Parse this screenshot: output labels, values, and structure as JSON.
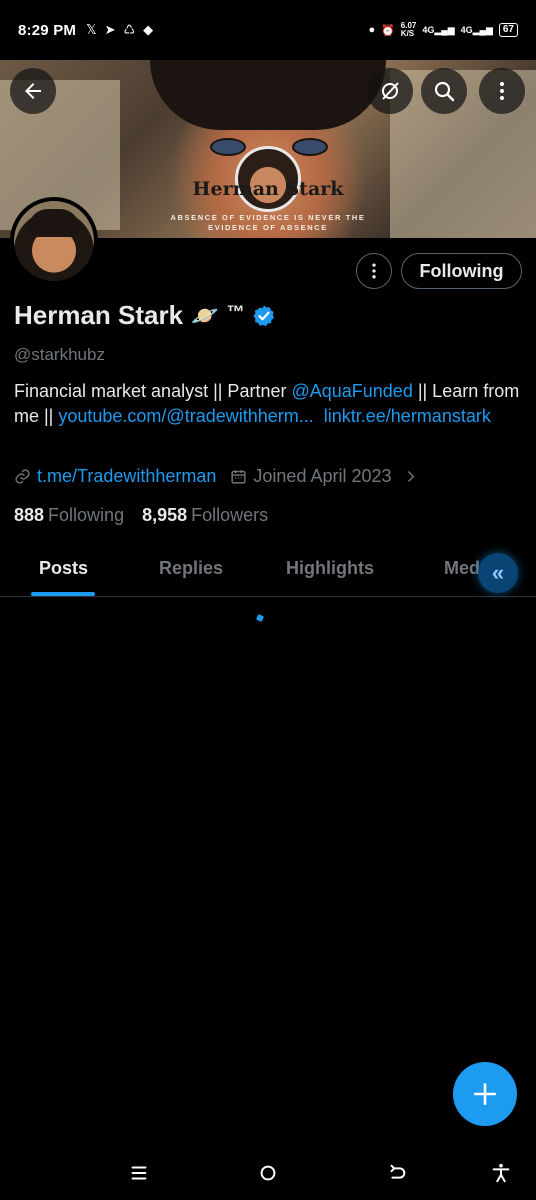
{
  "status_bar": {
    "time": "8:29 PM",
    "left_icons": [
      "x-icon",
      "telegram-icon",
      "recycle-icon",
      "android-icon"
    ],
    "net_speed": "6.07",
    "net_unit": "K/S",
    "signal_1": "4G",
    "signal_2": "4G",
    "battery": "67"
  },
  "banner": {
    "title": "Herman Stark",
    "subtitle_line1": "ABSENCE OF EVIDENCE IS NEVER THE",
    "subtitle_line2": "EVIDENCE OF ABSENCE"
  },
  "actions": {
    "following_label": "Following"
  },
  "profile": {
    "display_name": "Herman Stark",
    "name_emoji": "🪐",
    "name_suffix": "™",
    "handle": "@starkhubz",
    "bio_part1": "Financial market analyst || Partner ",
    "bio_mention": "@AquaFunded",
    "bio_part2": " || Learn from me || ",
    "bio_link1": "youtube.com/@tradewithherm...",
    "bio_sep": "  ",
    "bio_link2": "linktr.ee/hermanstark",
    "website": "t.me/Tradewithherman",
    "joined": "Joined April 2023",
    "following_count": "888",
    "following_label": "Following",
    "followers_count": "8,958",
    "followers_label": "Followers"
  },
  "tabs": [
    {
      "label": "Posts",
      "active": true
    },
    {
      "label": "Replies",
      "active": false
    },
    {
      "label": "Highlights",
      "active": false
    },
    {
      "label": "Med",
      "active": false
    }
  ],
  "colors": {
    "accent": "#1d9bf0",
    "background": "#000000",
    "text_primary": "#e7e9ea",
    "text_secondary": "#71767b"
  }
}
